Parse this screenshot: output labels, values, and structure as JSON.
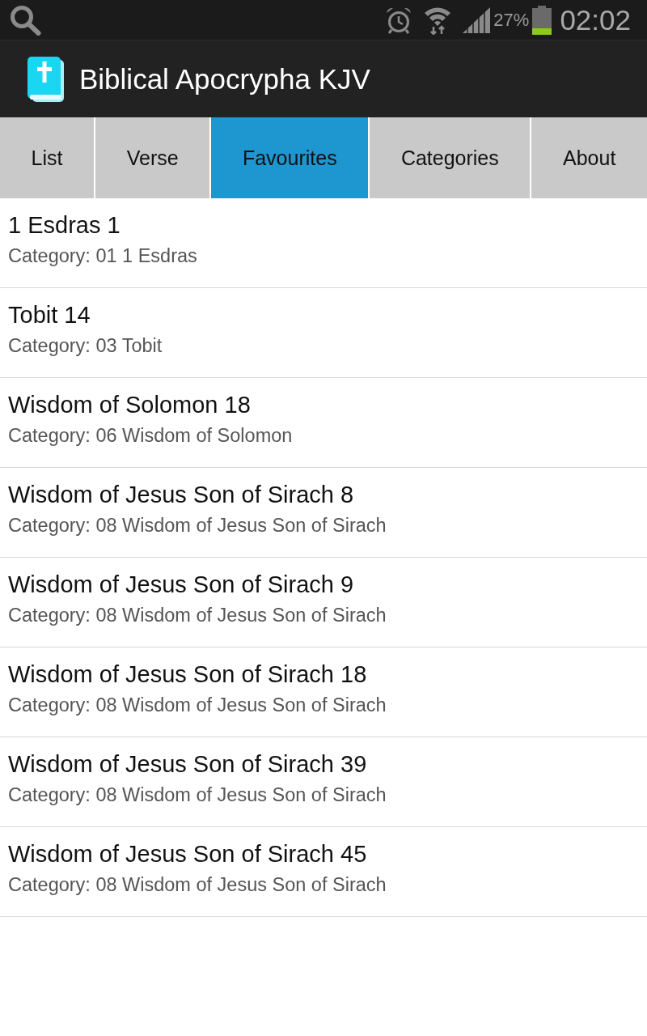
{
  "status_bar": {
    "battery_percent": "27%",
    "time": "02:02"
  },
  "app_bar": {
    "title": "Biblical Apocrypha KJV"
  },
  "tabs": [
    {
      "label": "List",
      "selected": false
    },
    {
      "label": "Verse",
      "selected": false
    },
    {
      "label": "Favourites",
      "selected": true
    },
    {
      "label": "Categories",
      "selected": false
    },
    {
      "label": "About",
      "selected": false
    }
  ],
  "favourites": [
    {
      "title": "1 Esdras 1",
      "category": "Category: 01 1 Esdras"
    },
    {
      "title": "Tobit 14",
      "category": "Category: 03 Tobit"
    },
    {
      "title": "Wisdom of Solomon 18",
      "category": "Category: 06 Wisdom of Solomon"
    },
    {
      "title": "Wisdom of Jesus Son of Sirach 8",
      "category": "Category: 08 Wisdom of Jesus Son of Sirach"
    },
    {
      "title": "Wisdom of Jesus Son of Sirach 9",
      "category": "Category: 08 Wisdom of Jesus Son of Sirach"
    },
    {
      "title": "Wisdom of Jesus Son of Sirach 18",
      "category": "Category: 08 Wisdom of Jesus Son of Sirach"
    },
    {
      "title": "Wisdom of Jesus Son of Sirach 39",
      "category": "Category: 08 Wisdom of Jesus Son of Sirach"
    },
    {
      "title": "Wisdom of Jesus Son of Sirach 45",
      "category": "Category: 08 Wisdom of Jesus Son of Sirach"
    }
  ]
}
